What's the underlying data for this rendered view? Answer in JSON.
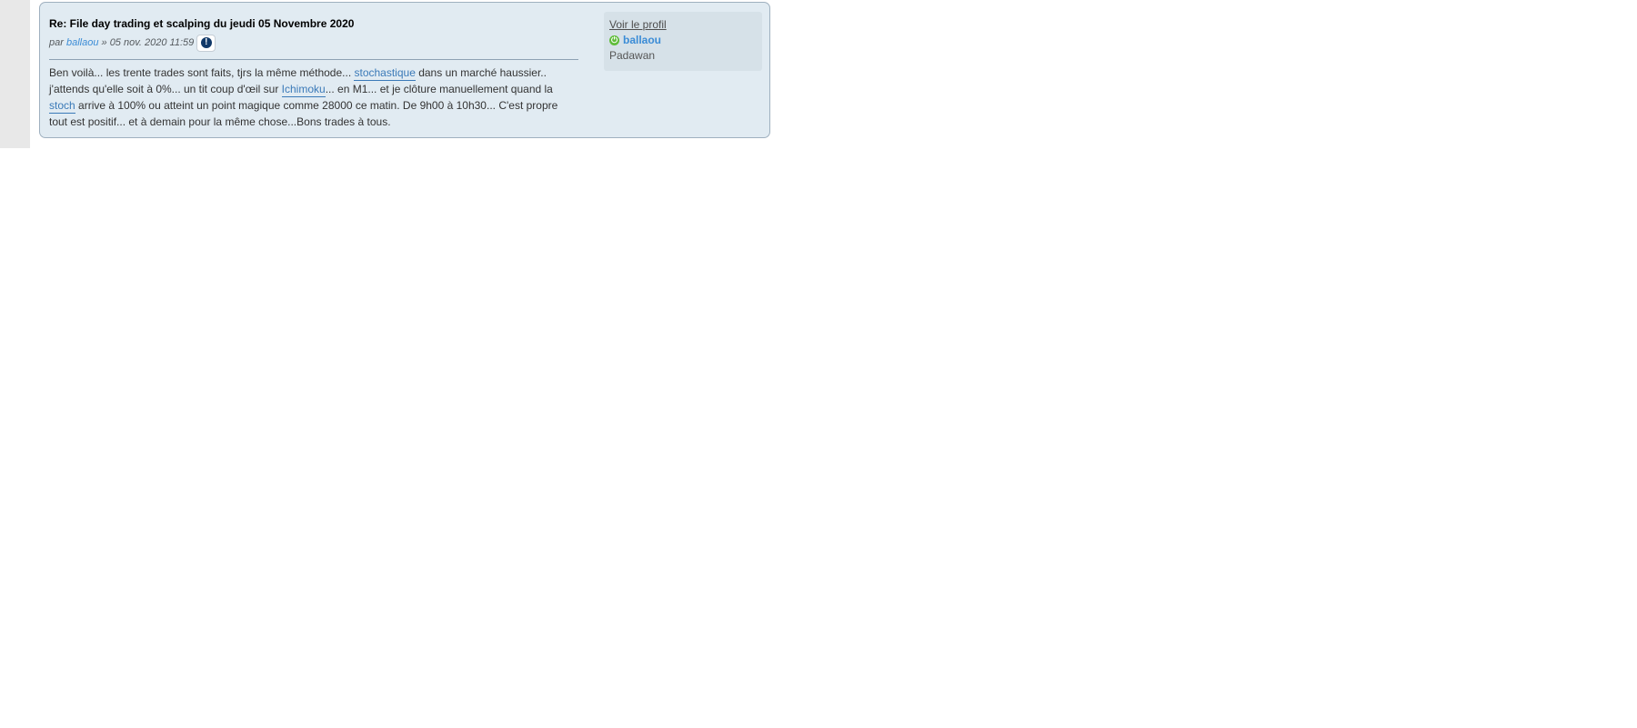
{
  "post": {
    "title": "Re: File day trading et scalping du jeudi 05 Novembre 2020",
    "meta": {
      "by_prefix": "par ",
      "author": "ballaou",
      "separator": " » ",
      "date": "05 nov. 2020 11:59",
      "report_icon": "exclamation-icon"
    },
    "content": {
      "t1": "Ben voilà... les trente trades sont faits, tjrs la même méthode... ",
      "k1": "stochastique",
      "t2": " dans un marché haussier.. j'attends qu'elle soit à 0%... un tit coup d'œil sur ",
      "k2": "Ichimoku",
      "t3": "... en M1... et je clôture manuellement quand la ",
      "k3": "stoch",
      "t4": " arrive à 100% ou atteint un point magique comme 28000 ce matin. De 9h00 à 10h30... C'est propre tout est positif... et à demain pour la même chose...Bons trades à tous."
    }
  },
  "profile": {
    "view_profile": "Voir le profil",
    "online_icon": "power-icon",
    "username": "ballaou",
    "rank": "Padawan"
  },
  "colors": {
    "post_bg": "#e1ebf2",
    "profile_bg": "#d6e1e8",
    "link": "#3b8cd6",
    "online": "#5fbd3a"
  }
}
